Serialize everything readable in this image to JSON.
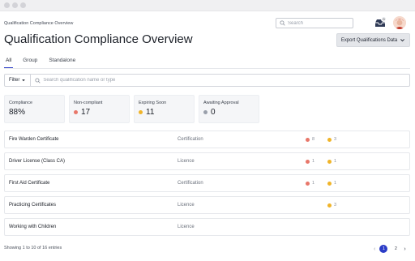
{
  "header": {
    "breadcrumb": "Qualification Compliance Overview",
    "search_placeholder": "Search",
    "inbox_badge": "0"
  },
  "page": {
    "title": "Qualification Compliance Overview",
    "export_label": "Export Qualifications Data"
  },
  "tabs": [
    {
      "label": "All",
      "active": true
    },
    {
      "label": "Group",
      "active": false
    },
    {
      "label": "Standalone",
      "active": false
    }
  ],
  "filter": {
    "button_label": "Filter",
    "search_placeholder": "Search qualification name or type"
  },
  "stats": {
    "compliance": {
      "label": "Compliance",
      "value": "88%"
    },
    "non_compliant": {
      "label": "Non-compliant",
      "value": "17",
      "color": "#e8776a"
    },
    "expiring_soon": {
      "label": "Expiring Soon",
      "value": "11",
      "color": "#f0b429"
    },
    "awaiting_approval": {
      "label": "Awaiting Approval",
      "value": "0",
      "color": "#9aa0ab"
    }
  },
  "colors": {
    "accent": "#2b3cc7",
    "red": "#e8776a",
    "amber": "#f0b429"
  },
  "rows": [
    {
      "name": "Fire Warden Certificate",
      "type": "Certification",
      "red": "8",
      "amber": "3"
    },
    {
      "name": "Driver License (Class CA)",
      "type": "Licence",
      "red": "1",
      "amber": "1"
    },
    {
      "name": "First Aid Certificate",
      "type": "Certification",
      "red": "1",
      "amber": "1"
    },
    {
      "name": "Practicing Certificates",
      "type": "Licence",
      "red": "",
      "amber": "3"
    },
    {
      "name": "Working with Children",
      "type": "Licence",
      "red": "",
      "amber": ""
    }
  ],
  "footer": {
    "entries_text": "Showing 1 to 10 of 16 entries",
    "prev_icon": "chevron-left-icon",
    "next_icon": "chevron-right-icon",
    "pages": [
      "1",
      "2"
    ],
    "current_page": "1"
  }
}
